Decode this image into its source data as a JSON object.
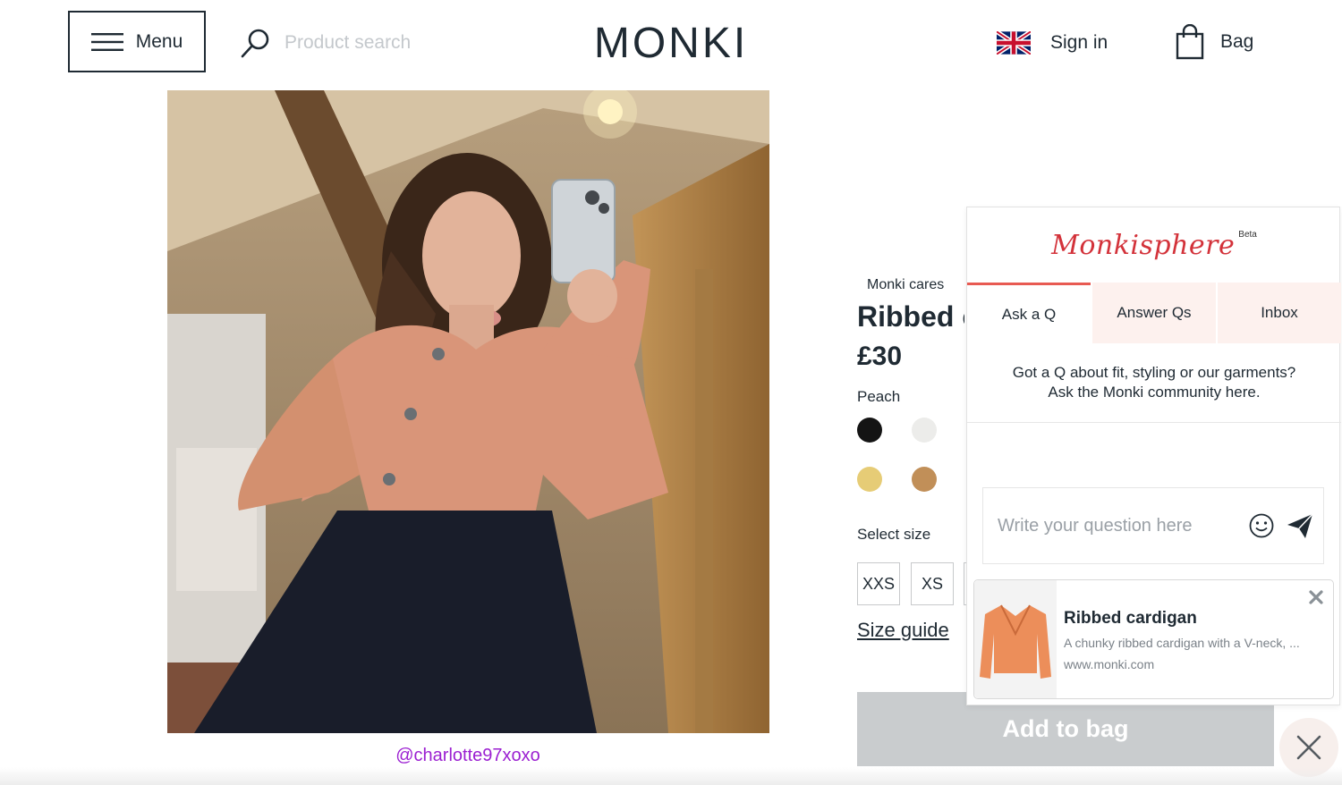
{
  "header": {
    "menu_label": "Menu",
    "search_placeholder": "Product search",
    "logo": "MONKI",
    "signin_label": "Sign in",
    "bag_label": "Bag"
  },
  "photo": {
    "credit": "@charlotte97xoxo"
  },
  "product": {
    "cares_label": "Monki cares",
    "title": "Ribbed cardigan",
    "price": "£30",
    "color_name": "Peach",
    "swatches": [
      "#141414",
      "#ececea",
      "#e6cc76",
      "#c18f58"
    ],
    "select_size_label": "Select size",
    "sizes": [
      "XXS",
      "XS"
    ],
    "size_guide_label": "Size guide",
    "add_to_bag_label": "Add to bag"
  },
  "widget": {
    "brand": "Monkisphere",
    "beta": "Beta",
    "tabs": [
      {
        "label": "Ask a Q",
        "active": true
      },
      {
        "label": "Answer Qs",
        "active": false
      },
      {
        "label": "Inbox",
        "active": false
      }
    ],
    "intro_line1": "Got a Q about fit, styling or our garments?",
    "intro_line2": "Ask the Monki community here.",
    "question_placeholder": "Write your question here",
    "card": {
      "title": "Ribbed cardigan",
      "description": "A chunky ribbed cardigan with a V-neck, ...",
      "url": "www.monki.com"
    }
  },
  "colors": {
    "accent": "#e85a52",
    "brand_script": "#d3323a",
    "credit_link": "#9b1fd1",
    "add_to_bag_bg": "#c9ccce"
  }
}
